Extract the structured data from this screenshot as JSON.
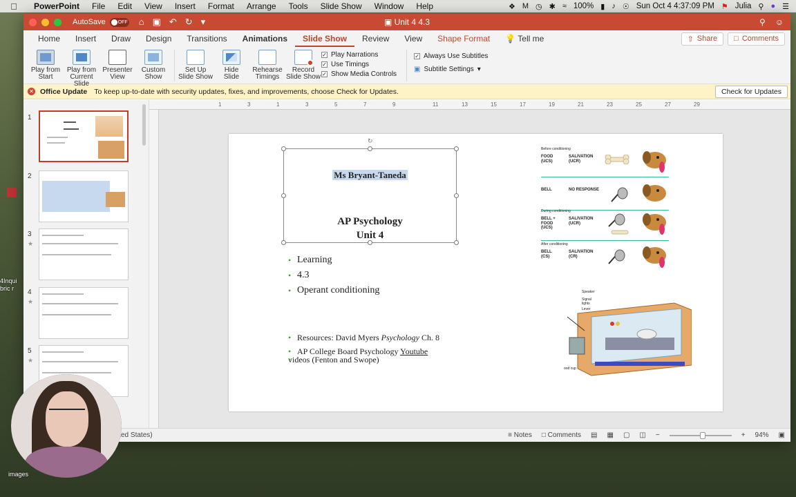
{
  "menubar": {
    "app": "PowerPoint",
    "items": [
      "File",
      "Edit",
      "View",
      "Insert",
      "Format",
      "Arrange",
      "Tools",
      "Slide Show",
      "Window",
      "Help"
    ],
    "battery": "100%",
    "datetime": "Sun Oct 4  4:37:09 PM",
    "user": "Julia"
  },
  "window": {
    "autosave_label": "AutoSave",
    "autosave_state": "OFF",
    "title": "Unit 4 4.3"
  },
  "ribbon_tabs": {
    "tabs": [
      "Home",
      "Insert",
      "Draw",
      "Design",
      "Transitions",
      "Animations",
      "Slide Show",
      "Review",
      "View",
      "Shape Format"
    ],
    "active": "Slide Show",
    "tell_me": "Tell me",
    "share": "Share",
    "comments": "Comments"
  },
  "ribbon": {
    "buttons": [
      {
        "line1": "Play from",
        "line2": "Start"
      },
      {
        "line1": "Play from",
        "line2": "Current Slide"
      },
      {
        "line1": "Presenter",
        "line2": "View"
      },
      {
        "line1": "Custom",
        "line2": "Show"
      },
      {
        "line1": "Set Up",
        "line2": "Slide Show"
      },
      {
        "line1": "Hide",
        "line2": "Slide"
      },
      {
        "line1": "Rehearse",
        "line2": "Timings"
      },
      {
        "line1": "Record",
        "line2": "Slide Show"
      }
    ],
    "checks": [
      "Play Narrations",
      "Use Timings",
      "Show Media Controls"
    ],
    "subtitles_check": "Always Use Subtitles",
    "subtitle_settings": "Subtitle Settings"
  },
  "message_bar": {
    "title": "Office Update",
    "text": "To keep up-to-date with security updates, fixes, and improvements, choose Check for Updates.",
    "button": "Check for Updates"
  },
  "thumbnails": [
    "1",
    "2",
    "3",
    "4",
    "5"
  ],
  "slide": {
    "name": "Ms Bryant-Taneda",
    "title_line1": "AP Psychology",
    "title_line2": "Unit 4",
    "bullets": [
      "Learning",
      "4.3",
      "Operant conditioning"
    ],
    "resources_prefix": "Resources: David Myers ",
    "resources_italic": "Psychology",
    "resources_suffix": " Ch. 8",
    "ap_prefix": "AP College Board Psychology ",
    "ap_link": "Youtube",
    "ap_line2": "videos (Fenton and Swope)"
  },
  "conditioning": {
    "rows": [
      {
        "stage": "Before conditioning",
        "left": "FOOD (UCS)",
        "mid": "SALIVATION (UCR)"
      },
      {
        "stage": "",
        "left": "BELL",
        "mid": "NO RESPONSE"
      },
      {
        "stage": "During conditioning",
        "left": "BELL + FOOD (UCS)",
        "mid": "SALIVATION (UCR)"
      },
      {
        "stage": "After conditioning",
        "left": "BELL (CS)",
        "mid": "SALIVATION (CR)"
      }
    ],
    "box_labels": [
      "Speaker",
      "Signal lights",
      "Lever",
      "ood cup"
    ]
  },
  "statusbar": {
    "language": "ited States)",
    "notes": "Notes",
    "comments": "Comments",
    "zoom": "94%"
  },
  "desktop": {
    "left_label": "images",
    "side_label1": "4Inqui",
    "side_label2": "bric r"
  }
}
